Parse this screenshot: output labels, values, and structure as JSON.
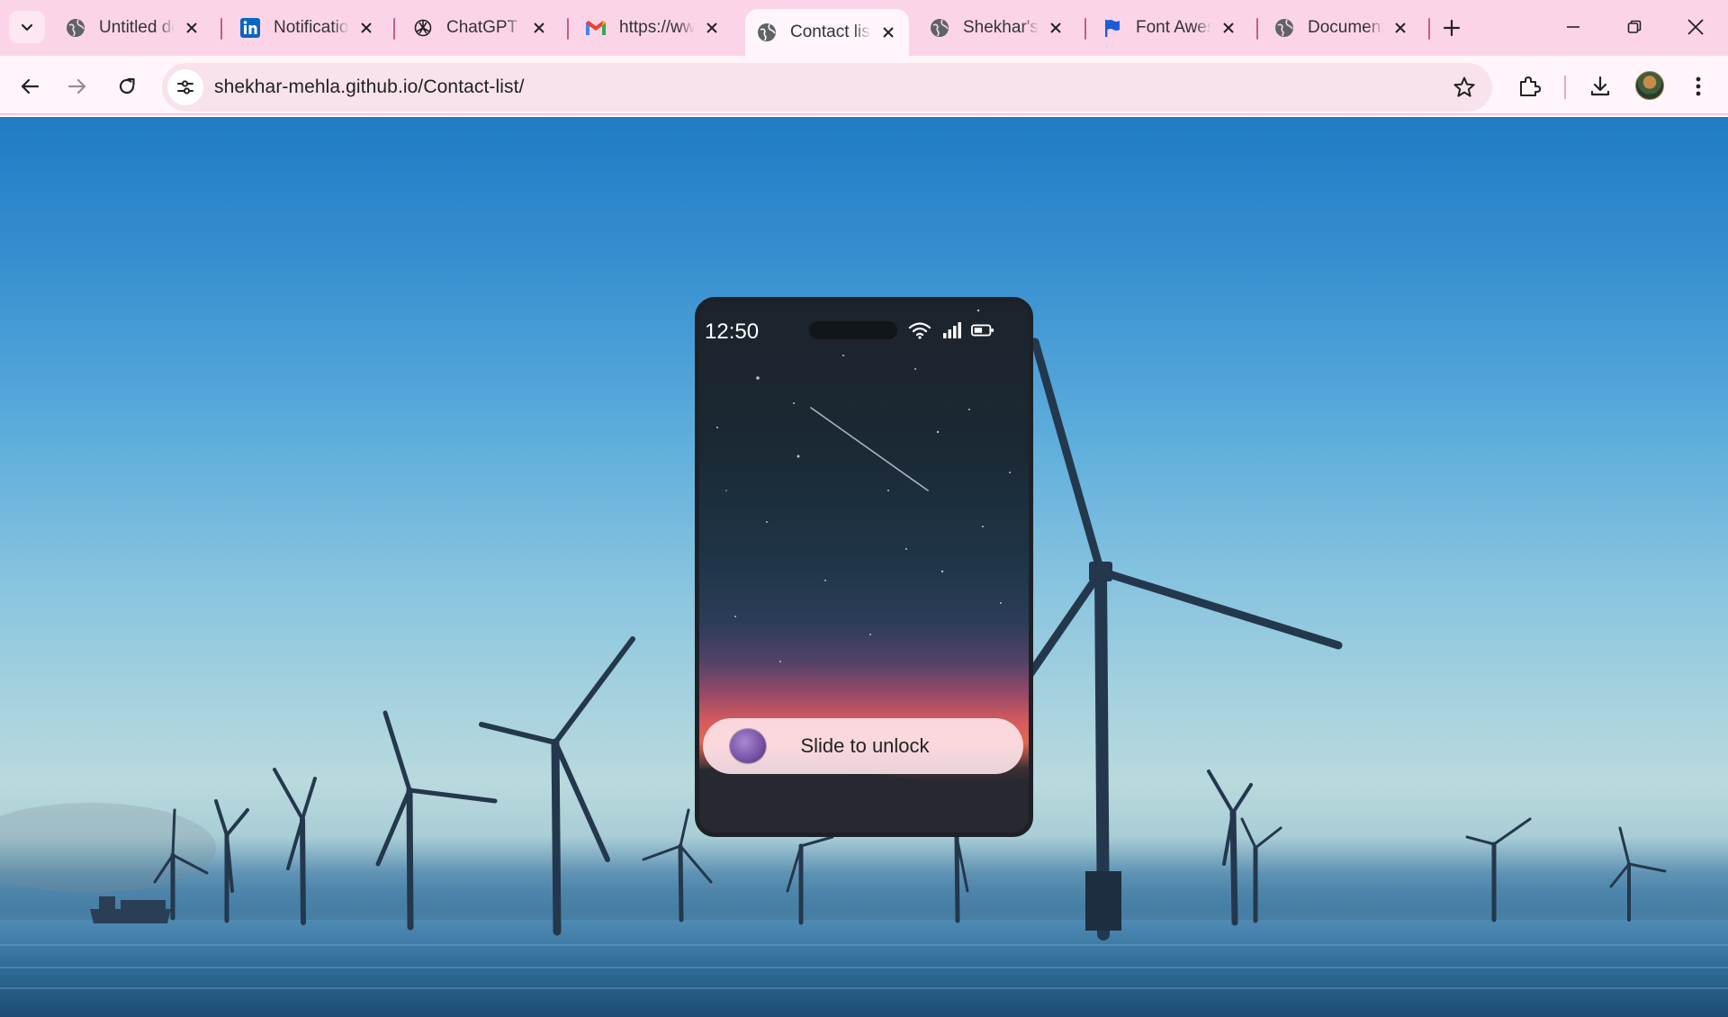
{
  "browser": {
    "tabs": [
      {
        "title": "Untitled do",
        "icon": "globe-icon",
        "active": false
      },
      {
        "title": "Notificatio",
        "icon": "linkedin-icon",
        "active": false
      },
      {
        "title": "ChatGPT",
        "icon": "chatgpt-icon",
        "active": false
      },
      {
        "title": "https://ww",
        "icon": "gmail-icon",
        "active": false
      },
      {
        "title": "Contact list",
        "icon": "globe-icon",
        "active": true
      },
      {
        "title": "Shekhar's",
        "icon": "globe-icon",
        "active": false
      },
      {
        "title": "Font Awes",
        "icon": "flag-icon",
        "active": false
      },
      {
        "title": "Document",
        "icon": "globe-icon",
        "active": false
      }
    ],
    "url": "shekhar-mehla.github.io/Contact-list/",
    "accent": "#fbd5e7",
    "toolbar_bg": "#fff5fa"
  },
  "phone": {
    "time": "12:50",
    "status_icons": [
      "wifi-icon",
      "signal-icon",
      "battery-icon"
    ],
    "slider_label": "Slide to unlock"
  }
}
